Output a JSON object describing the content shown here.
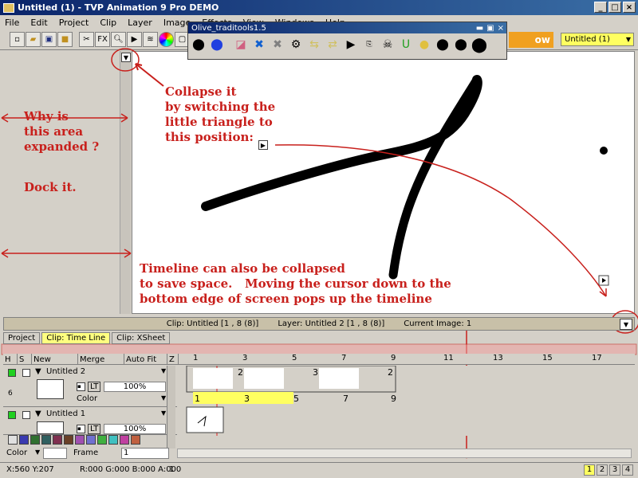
{
  "window": {
    "title": "Untitled (1) - TVP Animation 9 Pro DEMO"
  },
  "menu": [
    "File",
    "Edit",
    "Project",
    "Clip",
    "Layer",
    "Image",
    "Effects",
    "View",
    "Windows",
    "Help"
  ],
  "toolbar": {
    "fx_label": "FX",
    "project_select": "Untitled (1)",
    "promo_text": "ow"
  },
  "palette": {
    "title": "Olive_traditools1.5"
  },
  "annotations": {
    "collapse": "Collapse it\nby switching the\nlittle triangle to\nthis position:",
    "why": "Why is\nthis area\nexpanded ?",
    "dock": "Dock it.",
    "timeline": "Timeline can also be collapsed\nto save space.   Moving the cursor down to the\nbottom edge of screen pops up the timeline"
  },
  "status": {
    "clip": "Clip: Untitled [1 , 8  (8)]",
    "layer": "Layer: Untitled 2 [1 , 8  (8)]",
    "current": "Current Image: 1"
  },
  "tabs": [
    "Project",
    "Clip: Time Line",
    "Clip: XSheet"
  ],
  "timeline": {
    "h": "H",
    "s": "S",
    "new": "New",
    "merge": "Merge",
    "autofit": "Auto Fit",
    "z": "Z",
    "ruler": [
      "1",
      "3",
      "5",
      "7",
      "9",
      "11",
      "13",
      "15",
      "17"
    ],
    "layers": [
      {
        "name": "Untitled 2",
        "blend": "LT",
        "opacity": "100%",
        "mode": "Color",
        "index": "6"
      },
      {
        "name": "Untitled 1",
        "blend": "LT",
        "opacity": "100%"
      }
    ],
    "frame_labels_top": [
      "2",
      "3",
      "2"
    ],
    "frame_labels_bottom": [
      "1",
      "3",
      "5",
      "7",
      "9"
    ]
  },
  "footer": {
    "color_label": "Color",
    "frame_label": "Frame",
    "frame_value": "1",
    "coords": "X:560  Y:207",
    "rgba": "R:000 G:000 B:000 A:000",
    "value": "1",
    "pages": [
      "1",
      "2",
      "3",
      "4"
    ]
  },
  "colors": {
    "annotation": "#c8201c",
    "accent_yellow": "#ffff60",
    "title_blue": "#0a246a"
  }
}
